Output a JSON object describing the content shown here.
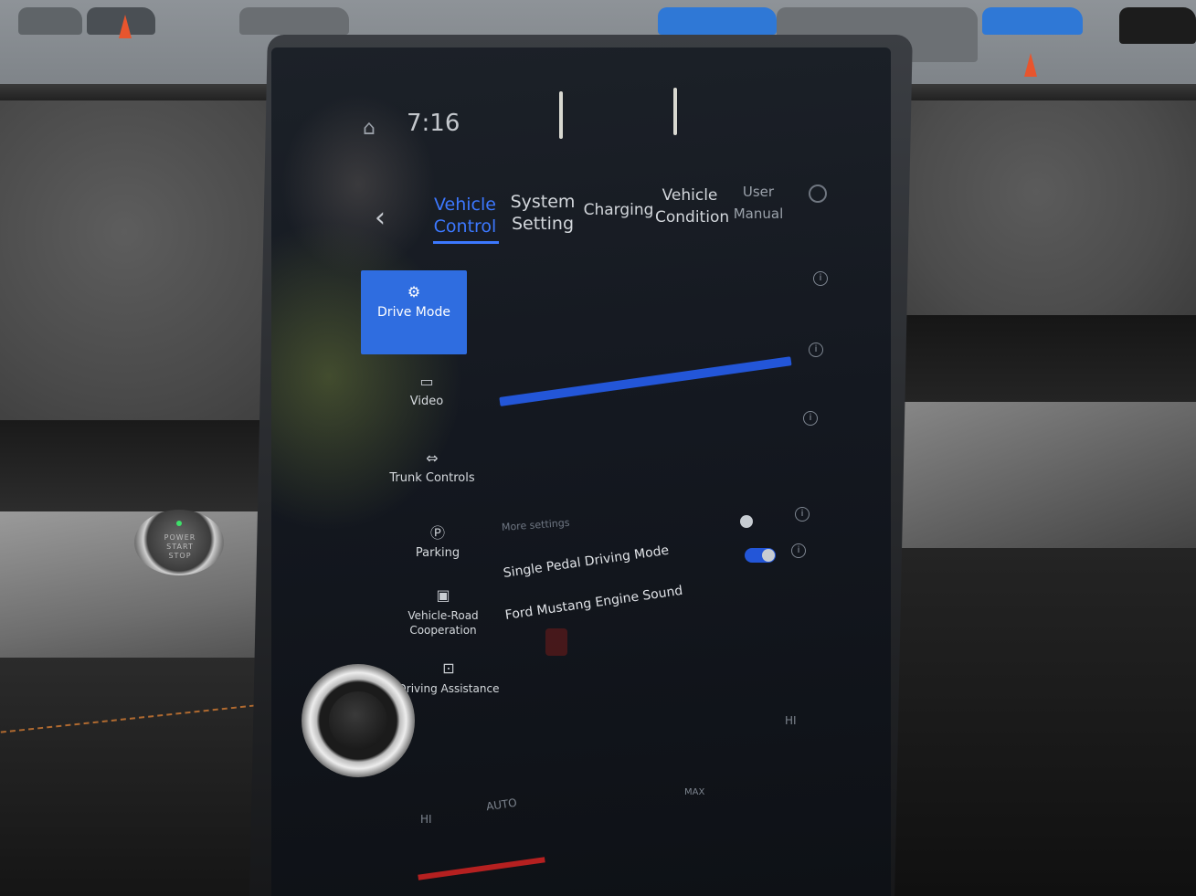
{
  "status_bar": {
    "time": "7:16",
    "home_icon": "home-icon"
  },
  "tabs": [
    {
      "label_line1": "Vehicle",
      "label_line2": "Control",
      "active": true
    },
    {
      "label_line1": "System",
      "label_line2": "Setting",
      "active": false
    },
    {
      "label_line1": "Charging",
      "label_line2": "",
      "active": false
    },
    {
      "label_line1": "Vehicle",
      "label_line2": "Condition",
      "active": false
    },
    {
      "label_line1": "User",
      "label_line2": "Manual",
      "active": false
    }
  ],
  "sidebar": {
    "items": [
      {
        "label": "Drive Mode",
        "icon": "drive-mode-icon",
        "active": true
      },
      {
        "label": "Video",
        "icon": "camera-icon",
        "active": false
      },
      {
        "label": "Trunk Controls",
        "icon": "trunk-icon",
        "active": false
      },
      {
        "label": "Parking",
        "icon": "parking-icon",
        "active": false
      },
      {
        "label_line1": "Vehicle-Road",
        "label_line2": "Cooperation",
        "icon": "vehicle-road-icon",
        "active": false
      },
      {
        "label": "Driving Assistance",
        "icon": "driving-assistance-icon",
        "active": false
      }
    ]
  },
  "settings": {
    "section_label": "More settings",
    "rows": [
      {
        "label": "Single Pedal Driving Mode",
        "toggle_on": false
      },
      {
        "label": "Ford Mustang Engine Sound",
        "toggle_on": true
      }
    ]
  },
  "climate": {
    "left_hi": "HI",
    "auto": "AUTO",
    "max": "MAX",
    "right_hi": "HI"
  },
  "colors": {
    "accent": "#3c78ff",
    "active_tile": "#2f6de0"
  },
  "dashboard": {
    "power_button_line1": "POWER",
    "power_button_line2": "START",
    "power_button_line3": "STOP"
  }
}
